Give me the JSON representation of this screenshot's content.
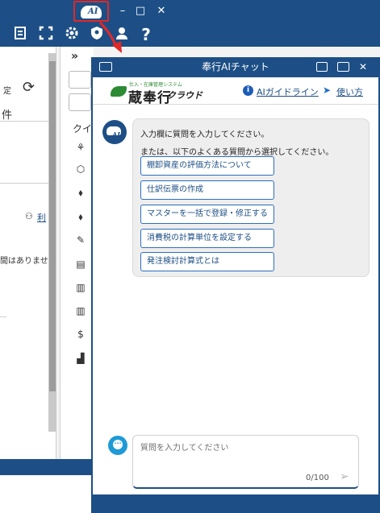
{
  "background_app": {
    "window_buttons": {
      "minimize": "–",
      "maximize": "□",
      "close": "✕"
    },
    "ai_button_text": "AI",
    "left_pane": {
      "fragment_settei": "定",
      "fragment_ken": "件",
      "fragment_ri": "利",
      "fragment_message": "間はありませ"
    },
    "mid_pane": {
      "chevron": "»",
      "fragment_kui": "クイ"
    }
  },
  "chat": {
    "title": "奉行AIチャット",
    "logo_small": "仕入・在庫管理システム",
    "logo_main": "蔵奉行",
    "logo_sub": "クラウド",
    "guideline_link": "AIガイドライン",
    "howto_link": "使い方",
    "bot_avatar_text": "AI",
    "message": {
      "line1": "入力欄に質問を入力してください。",
      "line2": "または、以下のよくある質問から選択してください。"
    },
    "suggestions": [
      "棚卸資産の評価方法について",
      "仕訳伝票の作成",
      "マスターを一括で登録・修正する",
      "消費税の計算単位を設定する",
      "発注検討計算式とは"
    ],
    "input": {
      "placeholder": "質問を入力してください",
      "counter": "0/100"
    },
    "colors": {
      "brand": "#1d4f86",
      "accent_border": "#2b6fbf",
      "highlight_box": "#e32727",
      "logo_green": "#2c8a34"
    }
  }
}
